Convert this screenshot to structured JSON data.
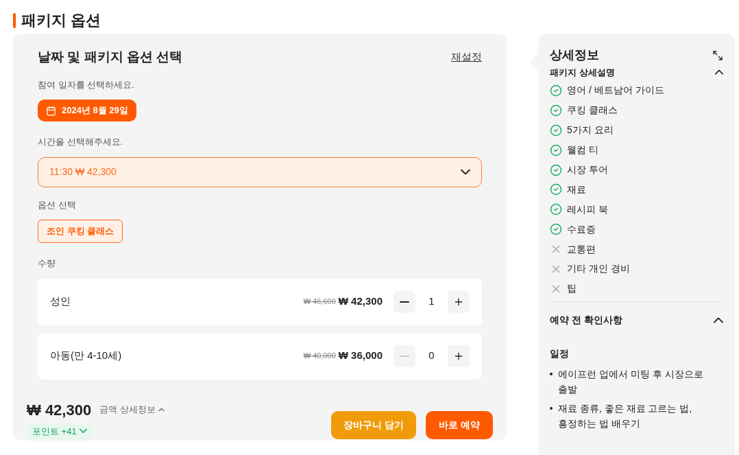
{
  "page_title": "패키지 옵션",
  "options": {
    "title": "날짜 및 패키지 옵션 선택",
    "reset": "재설정",
    "date_label": "참여 일자를 선택하세요.",
    "date": "2024년 8월 29일",
    "time_label": "시간을 선택해주세요.",
    "time_value": "11:30 ₩ 42,300",
    "option_label": "옵션 선택",
    "option_chips": [
      {
        "label": "조인 쿠킹 클래스",
        "selected": true
      }
    ],
    "quantity_label": "수량",
    "quantities": [
      {
        "name": "성인",
        "original_price": "₩ 46,600",
        "price": "₩ 42,300",
        "count": "1",
        "minus_disabled": false
      },
      {
        "name": "아동(만 4-10세)",
        "original_price": "₩ 40,000",
        "price": "₩ 36,000",
        "count": "0",
        "minus_disabled": true
      }
    ],
    "total": "₩ 42,300",
    "total_detail": "금액 상세정보",
    "points": "포인트 +41",
    "buttons": [
      {
        "label": "장바구니 담기",
        "kind": "cart"
      },
      {
        "label": "바로 예약",
        "kind": "book"
      }
    ]
  },
  "details": {
    "title": "상세정보",
    "section_title": "패키지 상세설명",
    "items": [
      {
        "label": "영어 / 베트남어 가이드",
        "included": true
      },
      {
        "label": "쿠킹 클래스",
        "included": true
      },
      {
        "label": "5가지 요리",
        "included": true
      },
      {
        "label": "웰컴 티",
        "included": true
      },
      {
        "label": "시장 투어",
        "included": true
      },
      {
        "label": "재료",
        "included": true
      },
      {
        "label": "레시피 북",
        "included": true
      },
      {
        "label": "수료증",
        "included": true
      },
      {
        "label": "교통편",
        "included": false
      },
      {
        "label": "기타 개인 경비",
        "included": false
      },
      {
        "label": "팁",
        "included": false
      }
    ],
    "notice_title": "예약 전 확인사항",
    "schedule_title": "일정",
    "schedule": [
      "에이프런 업에서 미팅 후 시장으로 출발",
      "재료 종류, 좋은 재료 고르는 법, 흥정하는 법 배우기"
    ]
  }
}
